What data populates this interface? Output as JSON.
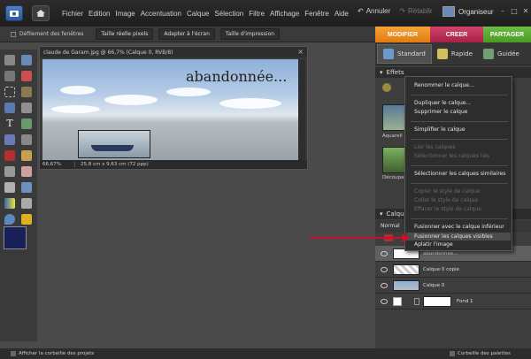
{
  "menubar": {
    "items": [
      "Fichier",
      "Edition",
      "Image",
      "Accentuation",
      "Calque",
      "Sélection",
      "Filtre",
      "Affichage",
      "Fenêtre",
      "Aide"
    ],
    "undo": "Annuler",
    "redo": "Rétablir",
    "organizer": "Organiseur"
  },
  "optbar": {
    "scroll_all": "Défilement des fenêtres",
    "actual_pixels": "Taille réelle pixels",
    "fit_screen": "Adapter à l'écran",
    "print_size": "Taille d'impression"
  },
  "modetabs": {
    "modify": "MODIFIER",
    "create": "CREER",
    "share": "PARTAGER"
  },
  "document": {
    "title": "claude de Garam.jpg @ 66,7% (Calque 0, RVB/8)",
    "canvas_text": "abandonnée...",
    "zoom": "66,67%",
    "size": "25,8 cm x 9,63 cm (72 ppp)"
  },
  "rpanel": {
    "tab_standard": "Standard",
    "tab_quick": "Rapide",
    "tab_guided": "Guidée",
    "effects_head": "Effets",
    "fx1": "Aquarell",
    "fx2": "Découpa",
    "layers_head": "Calque",
    "blend_mode": "Normal"
  },
  "layers": [
    {
      "name": "abandonnée..."
    },
    {
      "name": "Calque 0 copie"
    },
    {
      "name": "Calque 0"
    },
    {
      "name": "Fond 1"
    }
  ],
  "context_menu": {
    "rename": "Renommer le calque...",
    "duplicate": "Dupliquer le calque...",
    "delete": "Supprimer le calque",
    "simplify": "Simplifier le calque",
    "link": "Lier les calques",
    "select_linked": "Sélectionner les calques liés",
    "select_similar": "Sélectionner les calques similaires",
    "copy_style": "Copier le style de calque",
    "paste_style": "Coller le style de calque",
    "clear_style": "Effacer le style de calque",
    "merge_down": "Fusionner avec le calque inférieur",
    "merge_visible": "Fusionner les calques visibles",
    "flatten": "Aplatir l'image"
  },
  "bottombar": {
    "project_bin": "Afficher la corbeille des projets",
    "palette_bin": "Corbeille des palettes"
  },
  "colors": {
    "modify_tab": "#e8871f",
    "create_tab": "#b8305a",
    "share_tab": "#5aab34",
    "arrow": "#c8102e",
    "foreground": "#18205a"
  }
}
